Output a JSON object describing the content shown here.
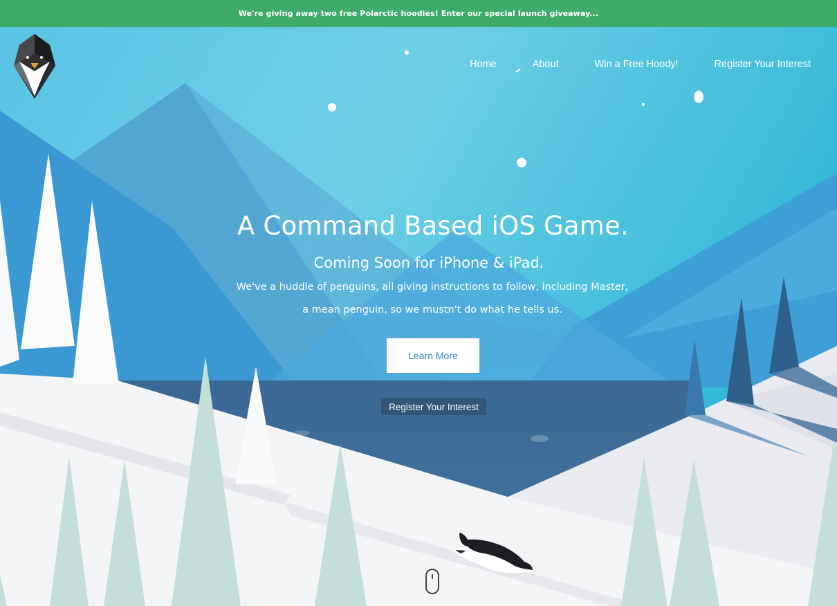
{
  "banner": {
    "text": "We're giving away two free Polarctic hoodies! Enter our special launch giveaway..."
  },
  "logo": {
    "icon": "penguin-logo-icon"
  },
  "nav": {
    "items": [
      {
        "label": "Home"
      },
      {
        "label": "About"
      },
      {
        "label": "Win a Free Hoody!"
      },
      {
        "label": "Register Your Interest"
      }
    ]
  },
  "hero": {
    "title": "A Command Based iOS Game.",
    "subtitle": "Coming Soon for iPhone & iPad.",
    "description_line1": "We've a huddle of penguins, all giving instructions to follow, including Master,",
    "description_line2": "a mean penguin, so we mustn't do what he tells us.",
    "cta_label": "Learn More",
    "register_label": "Register Your Interest"
  },
  "scroll_indicator": {
    "icon": "mouse-scroll-icon"
  },
  "colors": {
    "banner": "#3fab69",
    "sky": "#44bde0",
    "mountain": "#3c9fd8",
    "water": "#3d6c96",
    "snow": "#f3f4f6",
    "tree": "#c4ded9",
    "cta_text": "#2f86c3"
  }
}
